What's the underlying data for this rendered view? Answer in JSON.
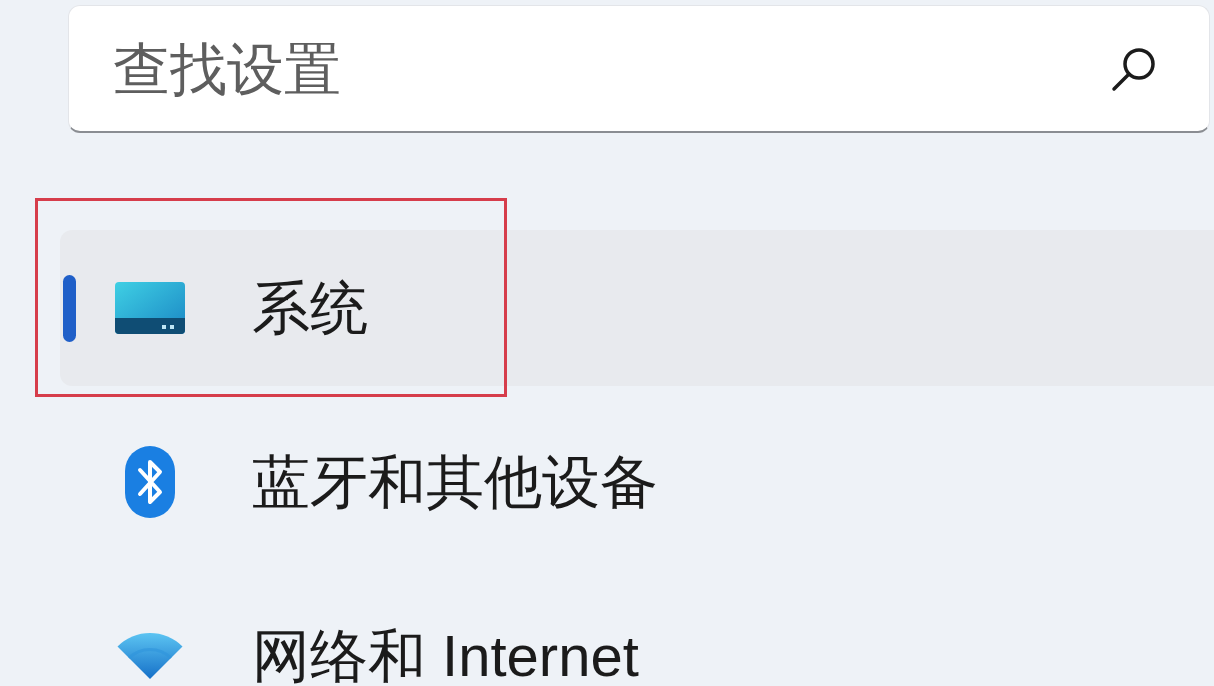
{
  "search": {
    "placeholder": "查找设置"
  },
  "nav_items": [
    {
      "label": "系统",
      "selected": true,
      "highlighted": true
    },
    {
      "label": "蓝牙和其他设备",
      "selected": false,
      "highlighted": false
    },
    {
      "label": "网络和 Internet",
      "selected": false,
      "highlighted": false
    }
  ]
}
